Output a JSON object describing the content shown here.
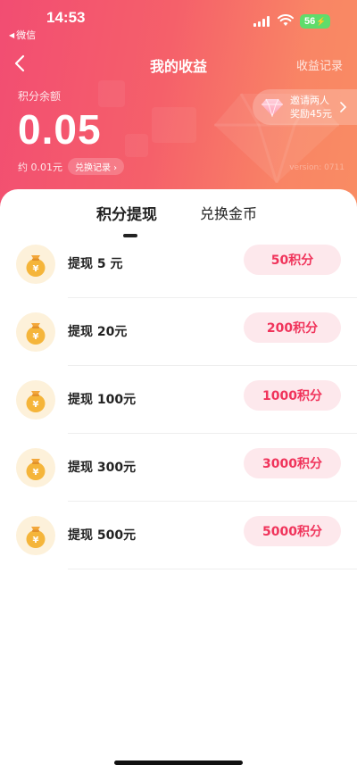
{
  "status_bar": {
    "time": "14:53",
    "back_app": "微信",
    "battery": "56"
  },
  "nav": {
    "title": "我的收益",
    "right_link": "收益记录"
  },
  "balance": {
    "label": "积分余额",
    "value": "0.05",
    "approx": "约 0.01元",
    "exchange_record": "兑换记录 ›",
    "version": "version: 0711"
  },
  "invite": {
    "line1": "邀请两人",
    "line2": "奖励45元"
  },
  "tabs": [
    {
      "label": "积分提现",
      "active": true
    },
    {
      "label": "兑换金币",
      "active": false
    }
  ],
  "items": [
    {
      "label": "提现 5 元",
      "button": "50积分"
    },
    {
      "label": "提现 20元",
      "button": "200积分"
    },
    {
      "label": "提现 100元",
      "button": "1000积分"
    },
    {
      "label": "提现 300元",
      "button": "3000积分"
    },
    {
      "label": "提现 500元",
      "button": "5000积分"
    }
  ],
  "colors": {
    "gradient_start": "#f24d72",
    "gradient_end": "#f98c63",
    "pill_bg": "#fde8ec",
    "pill_text": "#f0345b",
    "bag_gold": "#f5b53a"
  }
}
